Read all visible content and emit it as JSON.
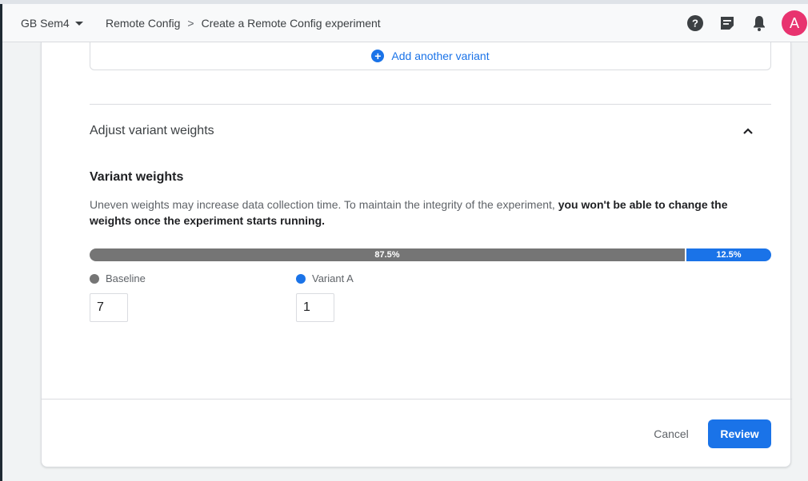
{
  "header": {
    "project": "GB Sem4",
    "breadcrumb": {
      "parent": "Remote Config",
      "separator": ">",
      "current": "Create a Remote Config experiment"
    },
    "avatar_initial": "A",
    "icons": [
      "help-icon",
      "feedback-icon",
      "notifications-icon"
    ]
  },
  "variants_section": {
    "add_variant_label": "Add another variant",
    "adjust_title": "Adjust variant weights",
    "weights_title": "Variant weights",
    "description_plain": "Uneven weights may increase data collection time. To maintain the integrity of the experiment, ",
    "description_bold": "you won't be able to change the weights once the experiment starts running.",
    "distribution": [
      {
        "name": "Baseline",
        "percent_label": "87.5%",
        "share": 0.875,
        "weight": "7",
        "color": "#757575"
      },
      {
        "name": "Variant A",
        "percent_label": "12.5%",
        "share": 0.125,
        "weight": "1",
        "color": "#1a73e8"
      }
    ]
  },
  "footer": {
    "cancel_label": "Cancel",
    "review_label": "Review"
  },
  "colors": {
    "accent": "#1a73e8",
    "avatar": "#e8336f",
    "baseline": "#757575"
  }
}
